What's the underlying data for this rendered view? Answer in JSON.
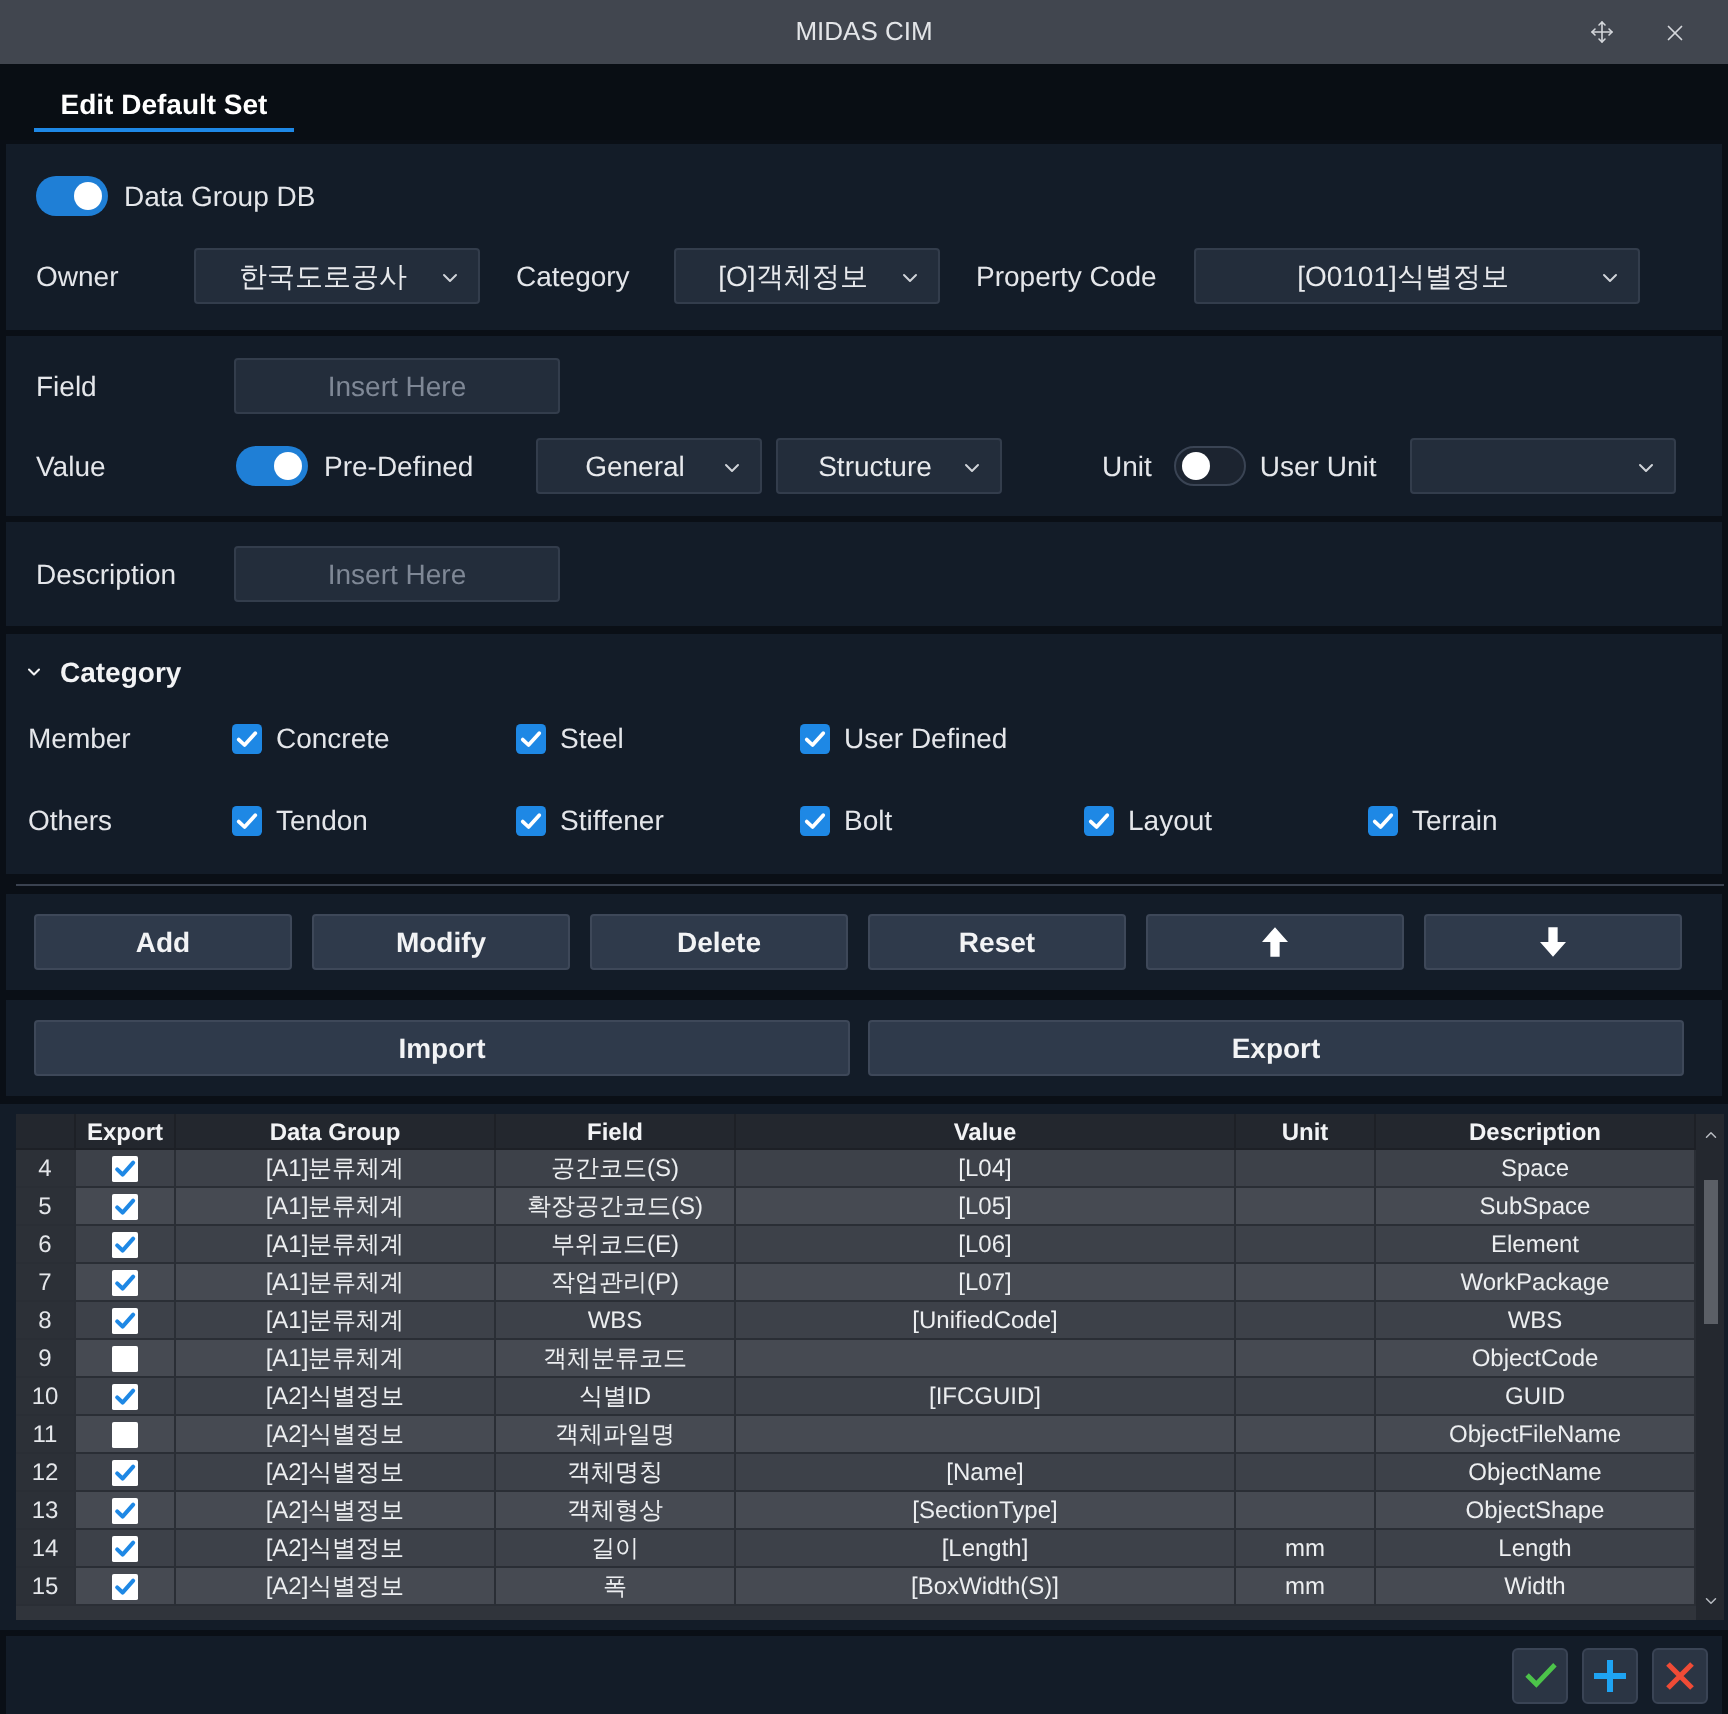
{
  "window": {
    "title": "MIDAS CIM"
  },
  "tabs": [
    {
      "label": "Edit Default Set",
      "selected": true
    }
  ],
  "data_group_db": {
    "label": "Data Group DB",
    "on": true
  },
  "selectors": [
    {
      "label": "Owner",
      "value": "한국도로공사"
    },
    {
      "label": "Category",
      "value": "[O]객체정보"
    },
    {
      "label": "Property Code",
      "value": "[O0101]식별정보"
    }
  ],
  "field": {
    "label": "Field",
    "placeholder": "Insert Here"
  },
  "value_row": {
    "label": "Value",
    "pre_defined": {
      "label": "Pre-Defined",
      "on": true
    },
    "dropdowns": [
      "General",
      "Structure"
    ],
    "unit": {
      "label": "Unit",
      "toggle_label": "User Unit",
      "on": false
    }
  },
  "description": {
    "label": "Description",
    "placeholder": "Insert Here"
  },
  "category": {
    "title": "Category",
    "expanded": true,
    "groups": [
      {
        "label": "Member",
        "options": [
          {
            "label": "Concrete",
            "checked": true
          },
          {
            "label": "Steel",
            "checked": true
          },
          {
            "label": "User Defined",
            "checked": true
          }
        ]
      },
      {
        "label": "Others",
        "options": [
          {
            "label": "Tendon",
            "checked": true
          },
          {
            "label": "Stiffener",
            "checked": true
          },
          {
            "label": "Bolt",
            "checked": true
          },
          {
            "label": "Layout",
            "checked": true
          },
          {
            "label": "Terrain",
            "checked": true
          }
        ]
      }
    ]
  },
  "actions": [
    {
      "kind": "text",
      "label": "Add"
    },
    {
      "kind": "text",
      "label": "Modify"
    },
    {
      "kind": "text",
      "label": "Delete"
    },
    {
      "kind": "text",
      "label": "Reset"
    },
    {
      "kind": "up"
    },
    {
      "kind": "down"
    }
  ],
  "transfer_buttons": [
    "Import",
    "Export"
  ],
  "table": {
    "columns": [
      "Export",
      "Data Group",
      "Field",
      "Value",
      "Unit",
      "Description"
    ],
    "rows": [
      {
        "number": "4",
        "export": true,
        "data_group": "[A1]분류체계",
        "field": "공간코드(S)",
        "value": "[L04]",
        "description": "Space"
      },
      {
        "number": "5",
        "export": true,
        "data_group": "[A1]분류체계",
        "field": "확장공간코드(S)",
        "value": "[L05]",
        "description": "SubSpace"
      },
      {
        "number": "6",
        "export": true,
        "data_group": "[A1]분류체계",
        "field": "부위코드(E)",
        "value": "[L06]",
        "description": "Element"
      },
      {
        "number": "7",
        "export": true,
        "data_group": "[A1]분류체계",
        "field": "작업관리(P)",
        "value": "[L07]",
        "description": "WorkPackage"
      },
      {
        "number": "8",
        "export": true,
        "data_group": "[A1]분류체계",
        "field": "WBS",
        "value": "[UnifiedCode]",
        "description": "WBS"
      },
      {
        "number": "9",
        "export": false,
        "data_group": "[A1]분류체계",
        "field": "객체분류코드",
        "description": "ObjectCode"
      },
      {
        "number": "10",
        "export": true,
        "data_group": "[A2]식별정보",
        "field": "식별ID",
        "value": "[IFCGUID]",
        "description": "GUID"
      },
      {
        "number": "11",
        "export": false,
        "data_group": "[A2]식별정보",
        "field": "객체파일명",
        "description": "ObjectFileName"
      },
      {
        "number": "12",
        "export": true,
        "data_group": "[A2]식별정보",
        "field": "객체명칭",
        "value": "[Name]",
        "description": "ObjectName"
      },
      {
        "number": "13",
        "export": true,
        "data_group": "[A2]식별정보",
        "field": "객체형상",
        "value": "[SectionType]",
        "description": "ObjectShape"
      },
      {
        "number": "14",
        "export": true,
        "data_group": "[A2]식별정보",
        "field": "길이",
        "value": "[Length]",
        "unit": "mm",
        "description": "Length"
      },
      {
        "number": "15",
        "export": true,
        "data_group": "[A2]식별정보",
        "field": "폭",
        "value": "[BoxWidth(S)]",
        "unit": "mm",
        "description": "Width"
      }
    ]
  }
}
